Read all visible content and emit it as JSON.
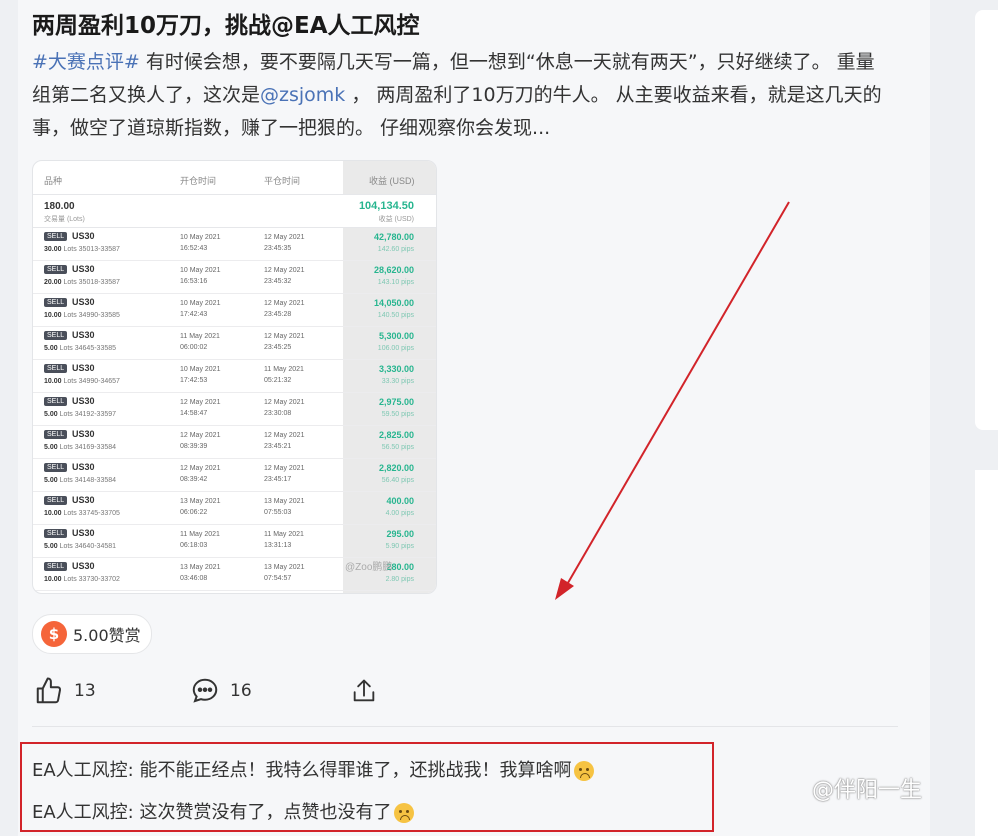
{
  "post": {
    "title": "两周盈利10万刀，挑战@EA人工风控",
    "hashtag": "#大赛点评#",
    "text_1": " 有时候会想，要不要隔几天写一篇，但一想到“休息一天就有两天”，只好继续了。 重量组第二名又换人了，这次是",
    "mention": "@zsjomk",
    "text_2": " ， 两周盈利了10万刀的牛人。 从主要收益来看，就是这几天的事，做空了道琼斯指数，赚了一把狠的。 仔细观察你会发现..."
  },
  "trades_table": {
    "headers": {
      "symbol": "品种",
      "open_time": "开仓时间",
      "close_time": "平仓时间",
      "profit": "收益 (USD)"
    },
    "summary": {
      "qty": "180.00",
      "qty_label": "交易量 (Lots)",
      "profit": "104,134.50",
      "profit_label": "收益 (USD)"
    },
    "rows": [
      {
        "side": "SELL",
        "symbol": "US30",
        "lots": "30.00",
        "range": "Lots 35013-33587",
        "open_date": "10 May 2021",
        "open_time": "16:52:43",
        "close_date": "12 May 2021",
        "close_time": "23:45:35",
        "profit": "42,780.00",
        "pips": "142.60 pips"
      },
      {
        "side": "SELL",
        "symbol": "US30",
        "lots": "20.00",
        "range": "Lots 35018-33587",
        "open_date": "10 May 2021",
        "open_time": "16:53:16",
        "close_date": "12 May 2021",
        "close_time": "23:45:32",
        "profit": "28,620.00",
        "pips": "143.10 pips"
      },
      {
        "side": "SELL",
        "symbol": "US30",
        "lots": "10.00",
        "range": "Lots 34990-33585",
        "open_date": "10 May 2021",
        "open_time": "17:42:43",
        "close_date": "12 May 2021",
        "close_time": "23:45:28",
        "profit": "14,050.00",
        "pips": "140.50 pips"
      },
      {
        "side": "SELL",
        "symbol": "US30",
        "lots": "5.00",
        "range": "Lots 34645-33585",
        "open_date": "11 May 2021",
        "open_time": "06:00:02",
        "close_date": "12 May 2021",
        "close_time": "23:45:25",
        "profit": "5,300.00",
        "pips": "106.00 pips"
      },
      {
        "side": "SELL",
        "symbol": "US30",
        "lots": "10.00",
        "range": "Lots 34990-34657",
        "open_date": "10 May 2021",
        "open_time": "17:42:53",
        "close_date": "11 May 2021",
        "close_time": "05:21:32",
        "profit": "3,330.00",
        "pips": "33.30 pips"
      },
      {
        "side": "SELL",
        "symbol": "US30",
        "lots": "5.00",
        "range": "Lots 34192-33597",
        "open_date": "12 May 2021",
        "open_time": "14:58:47",
        "close_date": "12 May 2021",
        "close_time": "23:30:08",
        "profit": "2,975.00",
        "pips": "59.50 pips"
      },
      {
        "side": "SELL",
        "symbol": "US30",
        "lots": "5.00",
        "range": "Lots 34169-33584",
        "open_date": "12 May 2021",
        "open_time": "08:39:39",
        "close_date": "12 May 2021",
        "close_time": "23:45:21",
        "profit": "2,825.00",
        "pips": "56.50 pips"
      },
      {
        "side": "SELL",
        "symbol": "US30",
        "lots": "5.00",
        "range": "Lots 34148-33584",
        "open_date": "12 May 2021",
        "open_time": "08:39:42",
        "close_date": "12 May 2021",
        "close_time": "23:45:17",
        "profit": "2,820.00",
        "pips": "56.40 pips"
      },
      {
        "side": "SELL",
        "symbol": "US30",
        "lots": "10.00",
        "range": "Lots 33745-33705",
        "open_date": "13 May 2021",
        "open_time": "06:06:22",
        "close_date": "13 May 2021",
        "close_time": "07:55:03",
        "profit": "400.00",
        "pips": "4.00 pips"
      },
      {
        "side": "SELL",
        "symbol": "US30",
        "lots": "5.00",
        "range": "Lots 34640-34581",
        "open_date": "11 May 2021",
        "open_time": "06:18:03",
        "close_date": "11 May 2021",
        "close_time": "13:31:13",
        "profit": "295.00",
        "pips": "5.90 pips"
      },
      {
        "side": "SELL",
        "symbol": "US30",
        "lots": "10.00",
        "range": "Lots 33730-33702",
        "open_date": "13 May 2021",
        "open_time": "03:46:08",
        "close_date": "13 May 2021",
        "close_time": "07:54:57",
        "profit": "280.00",
        "pips": "2.80 pips"
      }
    ],
    "watermark": "@Zoo鹏鹏"
  },
  "reward": {
    "icon": "coin-icon",
    "coin_symbol": "$",
    "label": "5.00赞赏"
  },
  "actions": {
    "likes": "13",
    "comments": "16"
  },
  "comments": [
    {
      "author": "EA人工风控:",
      "text": " 能不能正经点！我特么得罪谁了，还挑战我！我算啥啊"
    },
    {
      "author": "EA人工风控:",
      "text": " 这次赞赏没有了，点赞也没有了"
    }
  ],
  "colors": {
    "accent": "#4a72b6",
    "profit": "#27b58f",
    "highlight_border": "#d2242a",
    "arrow": "#d2242a",
    "coin": "#f5653a"
  },
  "page_watermark": "@伴阳一生"
}
